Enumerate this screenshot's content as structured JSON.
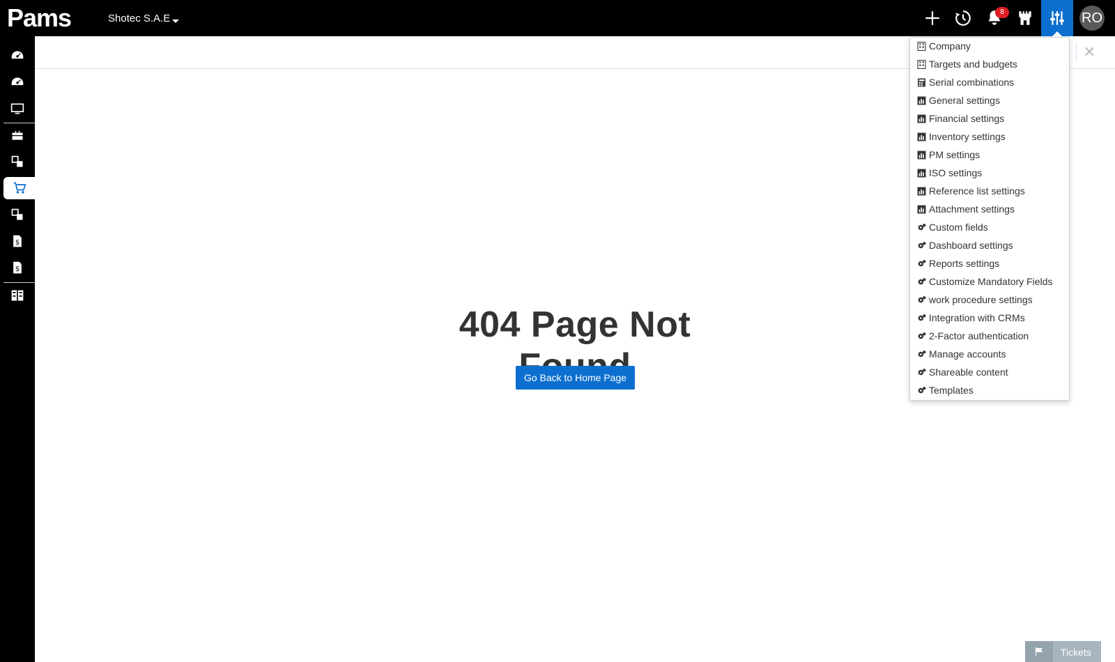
{
  "app": {
    "logo_text": "Pams",
    "company": "Shotec S.A.E",
    "notifications_count": "8",
    "user_initials": "RO"
  },
  "icons": {
    "add": "plus-icon",
    "history": "history-icon",
    "notifications": "bell-icon",
    "modules": "castle-icon",
    "settings": "sliders-icon"
  },
  "sidebar": {
    "items": [
      {
        "icon": "dashboard-icon"
      },
      {
        "icon": "dashboard-icon"
      },
      {
        "icon": "monitor-icon"
      },
      {
        "icon": "briefcase-icon"
      },
      {
        "icon": "boxes-icon"
      },
      {
        "icon": "cart-icon",
        "active": true
      },
      {
        "icon": "boxes-icon"
      },
      {
        "icon": "invoice-icon"
      },
      {
        "icon": "invoice-icon"
      },
      {
        "icon": "grid-icon"
      }
    ]
  },
  "main": {
    "title": "404 Page Not Found",
    "button_label": "Go Back to Home Page"
  },
  "settings_menu": {
    "items": [
      {
        "label": "Company",
        "icon": "building-icon"
      },
      {
        "label": "Targets and budgets",
        "icon": "building-icon"
      },
      {
        "label": "Serial combinations",
        "icon": "calculator-icon"
      },
      {
        "label": "General settings",
        "icon": "chart-icon"
      },
      {
        "label": "Financial settings",
        "icon": "chart-icon"
      },
      {
        "label": "Inventory settings",
        "icon": "chart-icon"
      },
      {
        "label": "PM settings",
        "icon": "chart-icon"
      },
      {
        "label": "ISO settings",
        "icon": "chart-icon"
      },
      {
        "label": "Reference list settings",
        "icon": "chart-icon"
      },
      {
        "label": "Attachment settings",
        "icon": "chart-icon"
      },
      {
        "label": "Custom fields",
        "icon": "gears-icon"
      },
      {
        "label": "Dashboard settings",
        "icon": "gears-icon"
      },
      {
        "label": "Reports settings",
        "icon": "gears-icon"
      },
      {
        "label": "Customize Mandatory Fields",
        "icon": "gears-icon"
      },
      {
        "label": "work procedure settings",
        "icon": "gears-icon"
      },
      {
        "label": "Integration with CRMs",
        "icon": "gears-icon"
      },
      {
        "label": "2-Factor authentication",
        "icon": "gears-icon"
      },
      {
        "label": "Manage accounts",
        "icon": "gears-icon"
      },
      {
        "label": "Shareable content",
        "icon": "gears-icon"
      },
      {
        "label": "Templates",
        "icon": "gears-icon"
      }
    ]
  },
  "tickets": {
    "label": "Tickets"
  },
  "colors": {
    "accent": "#0c6fcf",
    "topbar": "#000000",
    "badge": "#e01e25",
    "tickets_bg": "#a7b4be"
  }
}
